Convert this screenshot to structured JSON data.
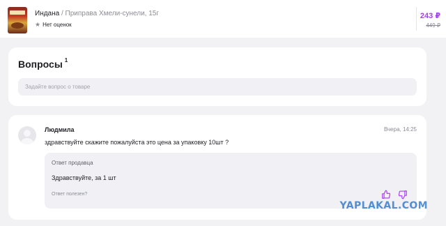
{
  "product": {
    "brand": "Индана",
    "separator": " / ",
    "name": "Приправа Хмели-сунели, 15г",
    "rating_text": "Нет оценок",
    "price_current": "243 ₽",
    "price_old": "449 ₽"
  },
  "questions": {
    "title": "Вопросы",
    "count": "1",
    "input_placeholder": "Задайте вопрос о товаре"
  },
  "question_item": {
    "author": "Людмила",
    "date": "Вчера, 14:25",
    "text": "здравствуйте скажите пожалуйста это цена за упаковку 10шт ?",
    "answer": {
      "label": "Ответ продавца",
      "text": "Здравствуйте, за 1 шт",
      "helpful_prompt": "Ответ полезен?"
    }
  },
  "watermark": "YAPLAKAL.COM",
  "colors": {
    "accent": "#a73afd",
    "background": "#f2f2f5",
    "card": "#ffffff",
    "muted_text": "#8b8b94",
    "watermark": "#1e6cc7"
  },
  "icons": {
    "rating": "star-icon",
    "vote_up": "thumbs-up-icon",
    "vote_down": "thumbs-down-icon",
    "avatar": "user-avatar-placeholder"
  }
}
